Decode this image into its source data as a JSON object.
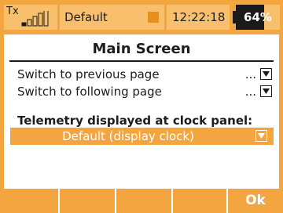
{
  "status_bar": {
    "tx_label": "Tx",
    "signal_strength": 0.25,
    "model_name": "Default",
    "time": "12:22:18",
    "battery_percent": 64,
    "battery_label": "64%"
  },
  "screen": {
    "title": "Main Screen",
    "rows": [
      {
        "label": "Switch to previous page",
        "value": "..."
      },
      {
        "label": "Switch to following page",
        "value": "..."
      }
    ],
    "section_heading": "Telemetry displayed at clock panel:",
    "selected_option": "Default (display clock)"
  },
  "softkeys": [
    "",
    "",
    "",
    "",
    "Ok"
  ],
  "colors": {
    "accent": "#f3a63f",
    "status_box": "#f8c06c",
    "text": "#1d1d1d"
  }
}
